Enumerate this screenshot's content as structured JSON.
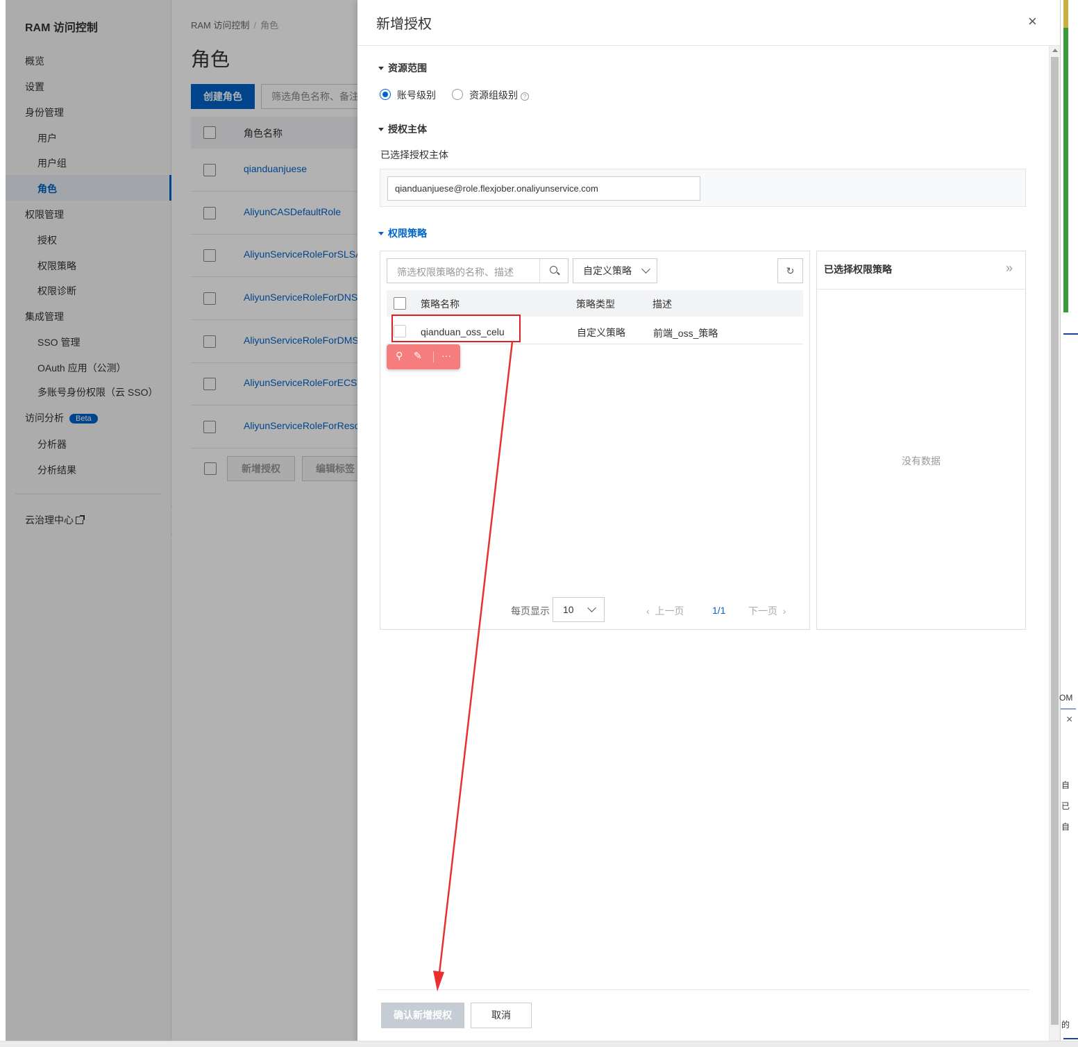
{
  "sidebar": {
    "brand": "RAM 访问控制",
    "items": [
      {
        "label": "概览"
      },
      {
        "label": "设置"
      },
      {
        "label": "身份管理"
      },
      {
        "label": "用户"
      },
      {
        "label": "用户组"
      },
      {
        "label": "角色"
      },
      {
        "label": "权限管理"
      },
      {
        "label": "授权"
      },
      {
        "label": "权限策略"
      },
      {
        "label": "权限诊断"
      },
      {
        "label": "集成管理"
      },
      {
        "label": "SSO 管理"
      },
      {
        "label": "OAuth 应用（公测）"
      },
      {
        "label": "多账号身份权限（云 SSO）"
      },
      {
        "label": "访问分析"
      },
      {
        "label": "分析器"
      },
      {
        "label": "分析结果"
      }
    ],
    "beta_badge": "Beta",
    "cloud_governance": "云治理中心"
  },
  "page": {
    "breadcrumb": [
      "RAM 访问控制",
      "/",
      "角色"
    ],
    "title": "角色",
    "create_button": "创建角色",
    "filter_placeholder": "筛选角色名称、备注",
    "column_role_name": "角色名称",
    "roles": [
      "qianduanjuese",
      "AliyunCASDefaultRole",
      "AliyunServiceRoleForSLSAu",
      "AliyunServiceRoleForDNS",
      "AliyunServiceRoleForDMS",
      "AliyunServiceRoleForECSW",
      "AliyunServiceRoleForResou"
    ],
    "add_auth_button": "新增授权",
    "edit_tag_button": "编辑标签"
  },
  "drawer": {
    "title": "新增授权",
    "close_icon": "×",
    "resource_scope": {
      "title": "资源范围",
      "options": [
        "账号级别",
        "资源组级别"
      ],
      "selected": "账号级别"
    },
    "principal": {
      "title": "授权主体",
      "selected_label": "已选择授权主体",
      "value": "qianduanjuese@role.flexjober.onaliyunservice.com"
    },
    "policies": {
      "title": "权限策略",
      "search_placeholder": "筛选权限策略的名称、描述",
      "type_select": "自定义策略",
      "columns": [
        "策略名称",
        "策略类型",
        "描述"
      ],
      "rows": [
        {
          "name": "qianduan_oss_celu",
          "type": "自定义策略",
          "desc": "前端_oss_策略"
        }
      ],
      "toolbar_more": "···",
      "page_size_label": "每页显示",
      "page_size": "10",
      "prev": "上一页",
      "page_indicator": "1/1",
      "next": "下一页"
    },
    "selected_policies": {
      "title": "已选择权限策略",
      "empty": "没有数据"
    },
    "confirm_button": "确认新增授权",
    "cancel_button": "取消"
  },
  "edge": {
    "om": "OM",
    "chars": [
      "自",
      "已",
      "自",
      "的"
    ]
  },
  "colors": {
    "primary": "#0064c8",
    "annotation": "#e02020"
  }
}
